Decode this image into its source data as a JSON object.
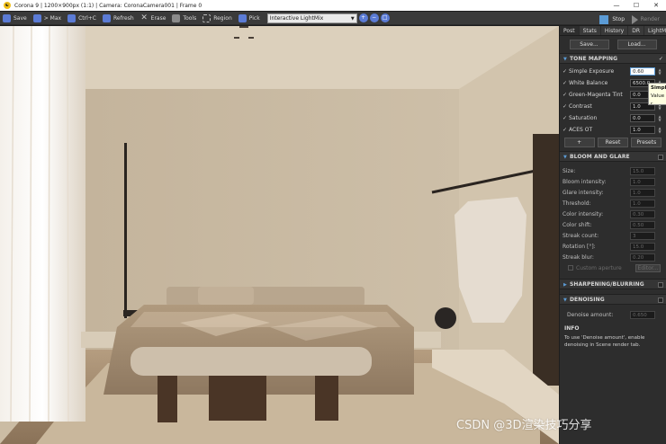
{
  "window": {
    "title": "Corona 9 | 1200×900px (1:1) | Camera: CoronaCamera001 | Frame 0",
    "logo_glyph": "☯"
  },
  "toolbar": {
    "save": "Save",
    "max": "> Max",
    "ctrl_c": "Ctrl+C",
    "refresh": "Refresh",
    "erase": "Erase",
    "tools": "Tools",
    "region": "Region",
    "pick": "Pick",
    "lightmix_select": "Interactive LightMix",
    "stop": "Stop",
    "render": "Render"
  },
  "panel": {
    "tabs": [
      "Post",
      "Stats",
      "History",
      "DR",
      "LightMix"
    ],
    "save_btn": "Save...",
    "load_btn": "Load...",
    "tone_mapping": {
      "title": "TONE MAPPING",
      "rows": [
        {
          "label": "Simple Exposure",
          "value": "0.60"
        },
        {
          "label": "White Balance",
          "value": "6500.0"
        },
        {
          "label": "Green-Magenta Tint",
          "value": "0.0"
        },
        {
          "label": "Contrast",
          "value": "1.0"
        },
        {
          "label": "Saturation",
          "value": "0.0"
        },
        {
          "label": "ACES OT",
          "value": "1.0"
        }
      ],
      "add_btn": "+",
      "reset_btn": "Reset",
      "presets_btn": "Presets"
    },
    "bloom": {
      "title": "BLOOM AND GLARE",
      "rows": [
        {
          "label": "Size:",
          "value": "15.0"
        },
        {
          "label": "Bloom intensity:",
          "value": "1.0"
        },
        {
          "label": "Glare intensity:",
          "value": "1.0"
        },
        {
          "label": "Threshold:",
          "value": "1.0"
        },
        {
          "label": "Color intensity:",
          "value": "0.30"
        },
        {
          "label": "Color shift:",
          "value": "0.50"
        },
        {
          "label": "Streak count:",
          "value": "3"
        },
        {
          "label": "Rotation [°]:",
          "value": "15.0"
        },
        {
          "label": "Streak blur:",
          "value": "0.20"
        }
      ],
      "custom_aperture": "Custom aperture",
      "editor_btn": "Editor..."
    },
    "sharpening": {
      "title": "SHARPENING/BLURRING"
    },
    "denoising": {
      "title": "DENOISING",
      "amount_label": "Denoise amount:",
      "amount_value": "0.650"
    },
    "info": {
      "title": "INFO",
      "text": "To use 'Denoise amount', enable denoising in Scene render tab."
    }
  },
  "tooltip": {
    "line1": "Simple",
    "line2": "Value r"
  },
  "watermark": "CSDN @3D渲染技巧分享",
  "colors": {
    "accent": "#5b9bd5",
    "panel_bg": "#2d2d2d",
    "toolbar_bg": "#3a3a3a"
  }
}
